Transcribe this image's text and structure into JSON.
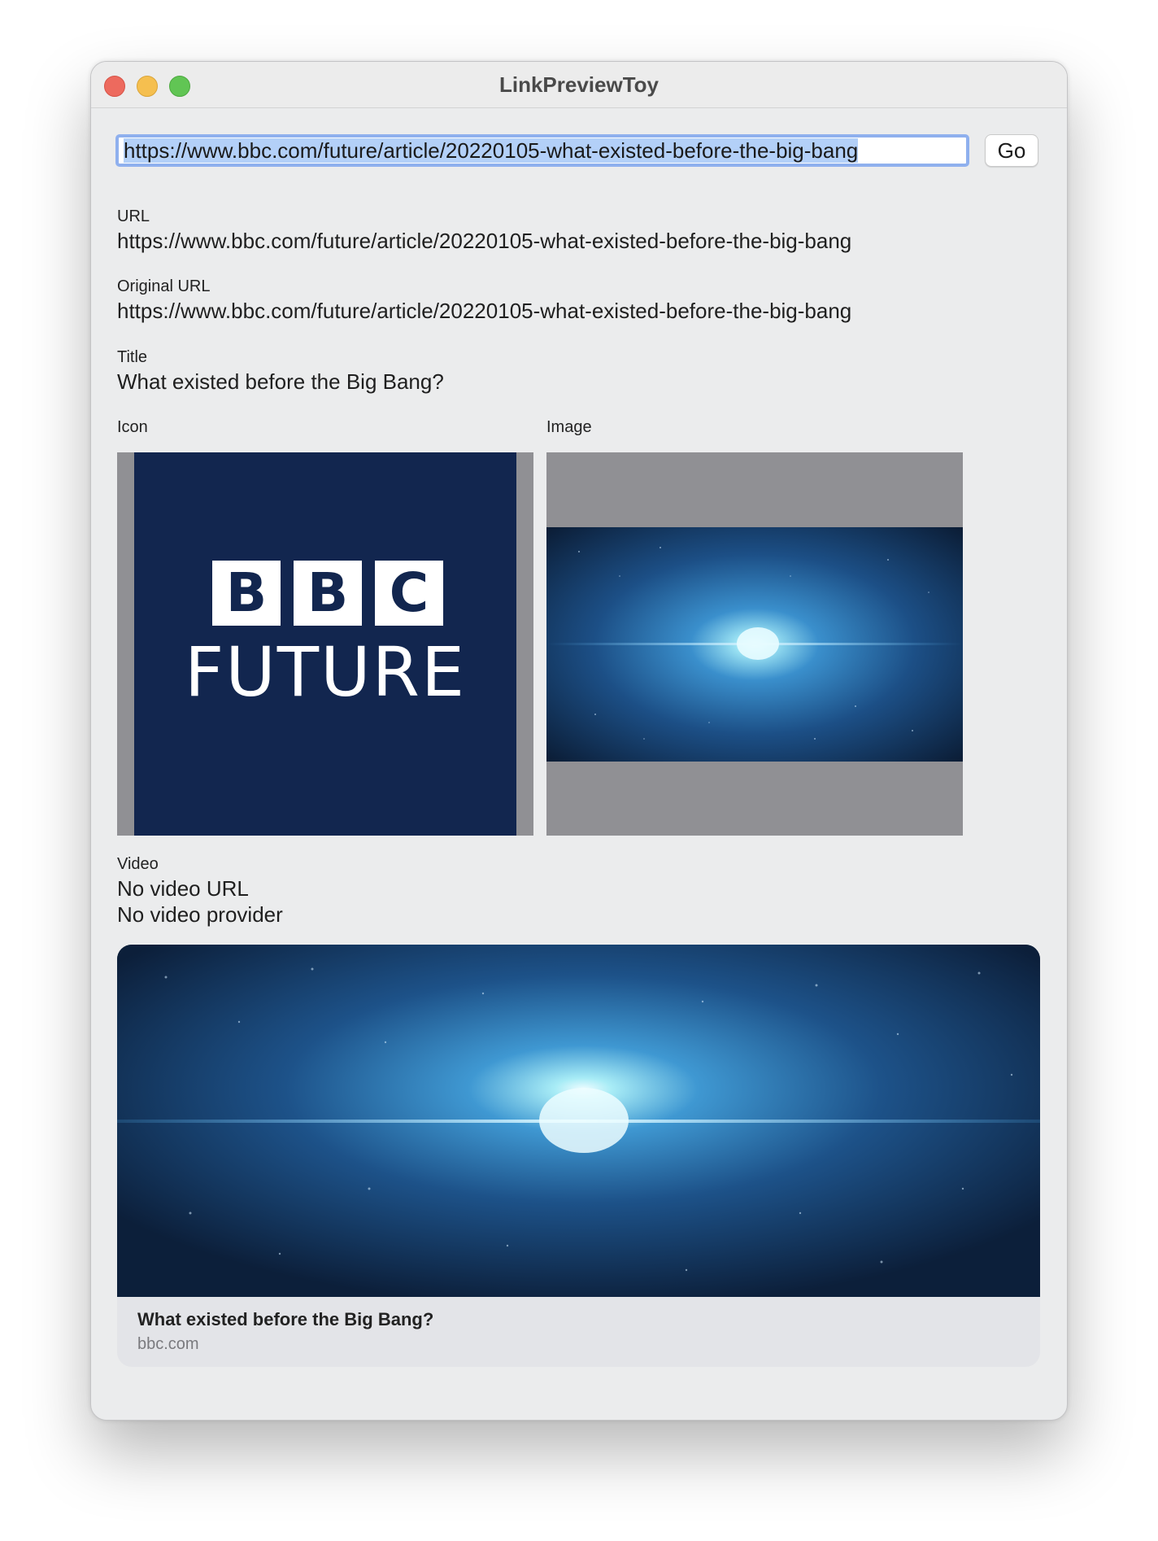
{
  "window": {
    "title": "LinkPreviewToy"
  },
  "toolbar": {
    "url_value": "https://www.bbc.com/future/article/20220105-what-existed-before-the-big-bang",
    "go_label": "Go"
  },
  "fields": {
    "url_label": "URL",
    "url_value": "https://www.bbc.com/future/article/20220105-what-existed-before-the-big-bang",
    "original_url_label": "Original URL",
    "original_url_value": "https://www.bbc.com/future/article/20220105-what-existed-before-the-big-bang",
    "title_label": "Title",
    "title_value": "What existed before the Big Bang?",
    "icon_label": "Icon",
    "image_label": "Image",
    "video_label": "Video",
    "video_url_value": "No video URL",
    "video_provider_value": "No video provider"
  },
  "icon_logo": {
    "letters": [
      "B",
      "B",
      "C"
    ],
    "wordmark": "FUTURE"
  },
  "preview": {
    "title": "What existed before the Big Bang?",
    "domain": "bbc.com"
  },
  "colors": {
    "window_bg": "#ebeced",
    "selection": "#b3d0f8",
    "focus_ring": "#8fb0ee",
    "bbc_navy": "#12264f",
    "image_letterbox": "#909094",
    "preview_footer": "#e3e4e8"
  }
}
